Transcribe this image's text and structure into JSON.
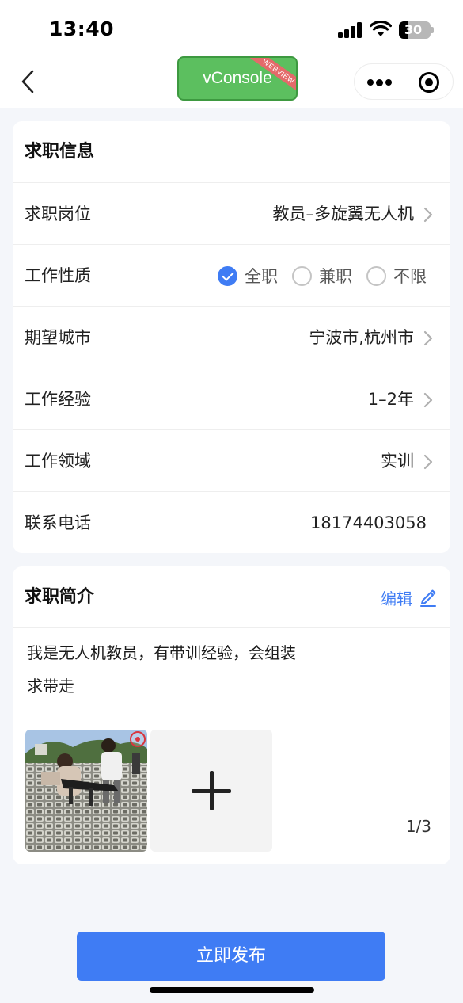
{
  "status_bar": {
    "time": "13:40",
    "battery": "30"
  },
  "nav": {
    "vconsole_label": "vConsole",
    "vconsole_ribbon": "WEBVIEW",
    "icons": {
      "back": "chevron-left-icon",
      "more": "more-dots-icon",
      "close": "target-circle-icon"
    }
  },
  "job_info": {
    "title": "求职信息",
    "position": {
      "label": "求职岗位",
      "value": "教员–多旋翼无人机"
    },
    "work_type": {
      "label": "工作性质",
      "options": [
        {
          "label": "全职",
          "checked": true
        },
        {
          "label": "兼职",
          "checked": false
        },
        {
          "label": "不限",
          "checked": false
        }
      ]
    },
    "city": {
      "label": "期望城市",
      "value": "宁波市,杭州市"
    },
    "experience": {
      "label": "工作经验",
      "value": "1–2年"
    },
    "field": {
      "label": "工作领域",
      "value": "实训"
    },
    "phone": {
      "label": "联系电话",
      "value": "18174403058"
    }
  },
  "intro": {
    "title": "求职简介",
    "edit_label": "编辑",
    "text_line1": "我是无人机教员，有带训经验，会组装",
    "text_line2": "求带走",
    "photo_count": "1/3"
  },
  "submit_label": "立即发布",
  "colors": {
    "accent": "#3f7cf4",
    "vconsole_green": "#5cbf5f",
    "delete_red": "#d9363e"
  }
}
